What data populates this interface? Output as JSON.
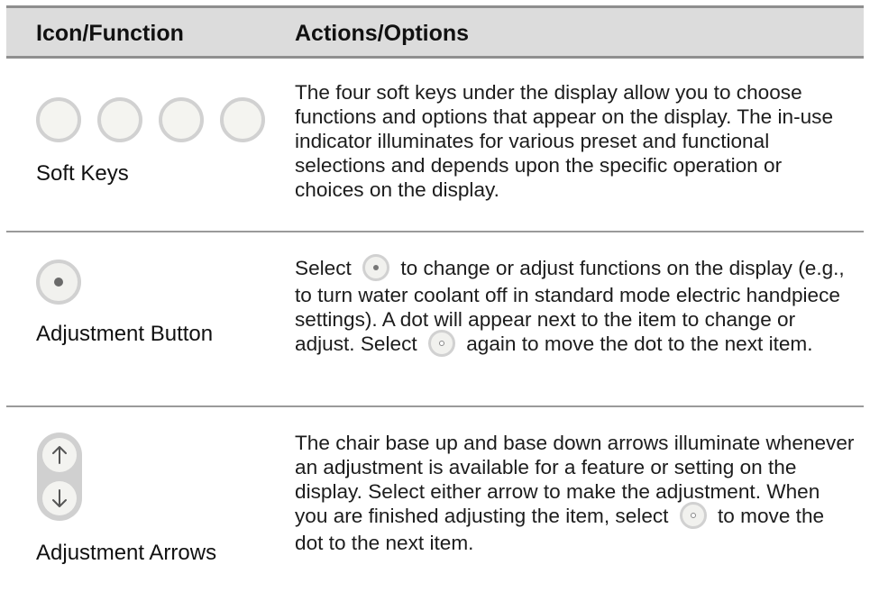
{
  "header": {
    "col1": "Icon/Function",
    "col2": "Actions/Options"
  },
  "rows": [
    {
      "icon": "soft-keys-icon",
      "label": "Soft Keys",
      "description": "The four soft keys under the display allow you to choose functions and options that appear on the display. The in-use indicator illuminates for various preset and functional selections and depends upon the specific operation or choices on the display."
    },
    {
      "icon": "adjustment-button-icon",
      "label": "Adjustment Button",
      "desc_parts": [
        "Select",
        "to change or adjust functions on the display (e.g., to turn water coolant off in standard mode electric handpiece settings). A dot will appear next to the item to change or adjust. Select",
        "again to move the dot to the next item."
      ]
    },
    {
      "icon": "adjustment-arrows-icon",
      "label": "Adjustment Arrows",
      "desc_parts": [
        "The chair base up and base down arrows illuminate whenever an adjustment is available for a feature or setting on the display. Select either arrow to make the adjustment. When you are finished adjusting the item, select",
        "to move the dot to the next item."
      ]
    }
  ]
}
